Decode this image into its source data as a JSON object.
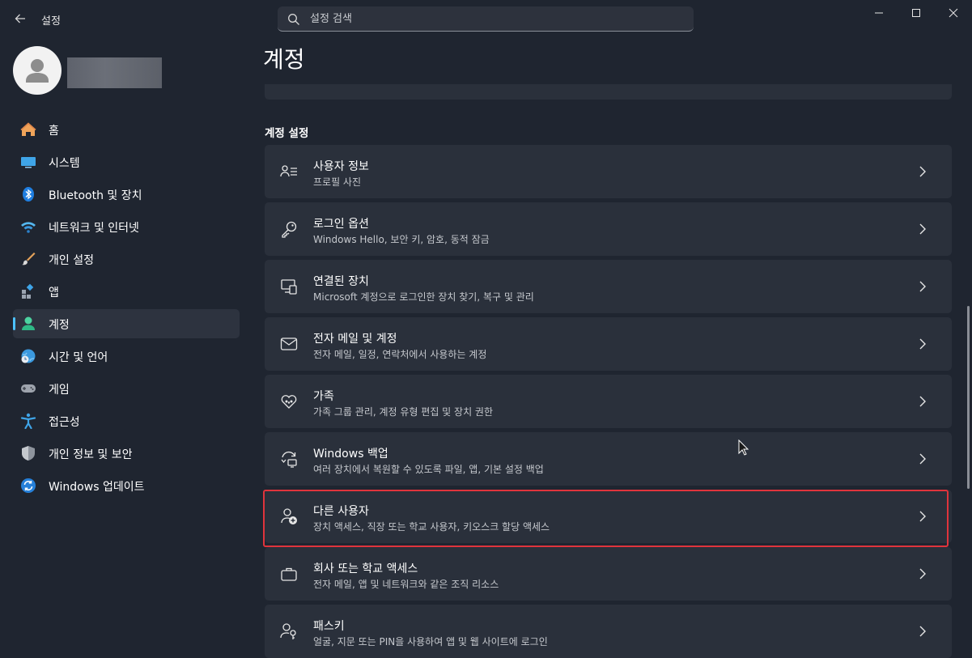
{
  "app": {
    "title": "설정"
  },
  "search": {
    "placeholder": "설정 검색"
  },
  "nav": {
    "items": [
      {
        "label": "홈",
        "icon": "home-icon"
      },
      {
        "label": "시스템",
        "icon": "system-display-icon"
      },
      {
        "label": "Bluetooth 및 장치",
        "icon": "bluetooth-icon"
      },
      {
        "label": "네트워크 및 인터넷",
        "icon": "wifi-icon"
      },
      {
        "label": "개인 설정",
        "icon": "paintbrush-icon"
      },
      {
        "label": "앱",
        "icon": "apps-icon"
      },
      {
        "label": "계정",
        "icon": "account-icon",
        "selected": true
      },
      {
        "label": "시간 및 언어",
        "icon": "globe-clock-icon"
      },
      {
        "label": "게임",
        "icon": "gamepad-icon"
      },
      {
        "label": "접근성",
        "icon": "accessibility-icon"
      },
      {
        "label": "개인 정보 및 보안",
        "icon": "shield-icon"
      },
      {
        "label": "Windows 업데이트",
        "icon": "update-icon"
      }
    ]
  },
  "main": {
    "page_title": "계정",
    "section_title": "계정 설정",
    "cards": [
      {
        "title": "사용자 정보",
        "subtitle": "프로필 사진",
        "icon": "user-info-icon"
      },
      {
        "title": "로그인 옵션",
        "subtitle": "Windows Hello, 보안 키, 암호, 동적 잠금",
        "icon": "key-icon"
      },
      {
        "title": "연결된 장치",
        "subtitle": "Microsoft 계정으로 로그인한 장치 찾기, 복구 및 관리",
        "icon": "linked-devices-icon"
      },
      {
        "title": "전자 메일 및 계정",
        "subtitle": "전자 메일, 일정, 연락처에서 사용하는 계정",
        "icon": "mail-icon"
      },
      {
        "title": "가족",
        "subtitle": "가족 그룹 관리, 계정 유형 편집 및 장치 권한",
        "icon": "family-heart-icon"
      },
      {
        "title": "Windows 백업",
        "subtitle": "여러 장치에서 복원할 수 있도록 파일, 앱, 기본 설정 백업",
        "icon": "backup-icon"
      },
      {
        "title": "다른 사용자",
        "subtitle": "장치 액세스, 직장 또는 학교 사용자, 키오스크 할당 액세스",
        "icon": "add-user-icon",
        "highlighted": true
      },
      {
        "title": "회사 또는 학교 액세스",
        "subtitle": "전자 메일, 앱 및 네트워크와 같은 조직 리소스",
        "icon": "briefcase-icon"
      },
      {
        "title": "패스키",
        "subtitle": "얼굴, 지문 또는 PIN을 사용하여 앱 및 웹 사이트에 로그인",
        "icon": "passkey-icon"
      }
    ]
  },
  "colors": {
    "accent": "#4cc2ff",
    "highlight_border": "#e0343c",
    "background": "#1f2530",
    "card": "#2a303b"
  }
}
